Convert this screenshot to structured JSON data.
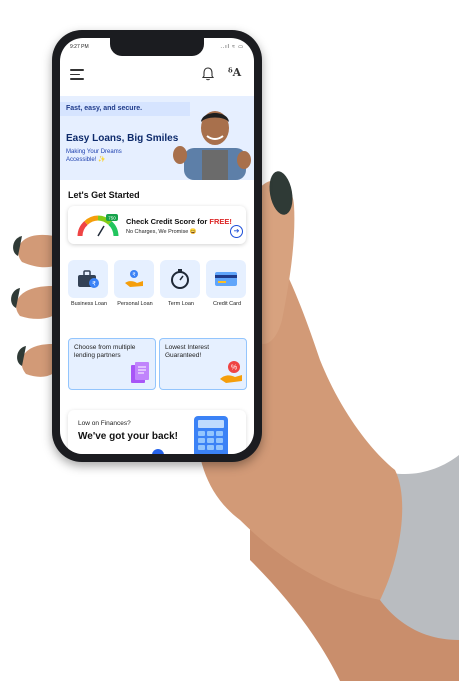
{
  "status_bar": {
    "time": "9:27 PM",
    "signal": "..ıl ≈ ▭"
  },
  "header": {
    "logo_text": "ᵟA"
  },
  "banner": {
    "tagline": "Fast, easy, and secure.",
    "title": "Easy Loans, Big Smiles",
    "subtitle": "Making Your Dreams Accessible! ✨"
  },
  "section": {
    "title": "Let's Get Started"
  },
  "credit_card": {
    "title_prefix": "Check Credit Score for ",
    "title_highlight": "FREE!",
    "subtitle": "No Charges, We Promise 😄",
    "gauge_badge": "750"
  },
  "loan_types": [
    {
      "label": "Business Loan",
      "icon": "business-bag-icon"
    },
    {
      "label": "Personal Loan",
      "icon": "money-hand-icon"
    },
    {
      "label": "Term Loan",
      "icon": "stopwatch-icon"
    },
    {
      "label": "Credit Card",
      "icon": "credit-card-icon"
    }
  ],
  "promos": [
    {
      "text": "Choose from multiple lending partners",
      "icon": "documents-icon"
    },
    {
      "text": "Lowest Interest Guaranteed!",
      "icon": "percent-hand-icon"
    }
  ],
  "bottom_card": {
    "small": "Low on Finances?",
    "big": "We've got your back!"
  },
  "colors": {
    "accent": "#1d4ed8",
    "banner_bg": "#e6efff",
    "highlight_red": "#dc2626",
    "tile_bg": "#e6f0ff"
  }
}
